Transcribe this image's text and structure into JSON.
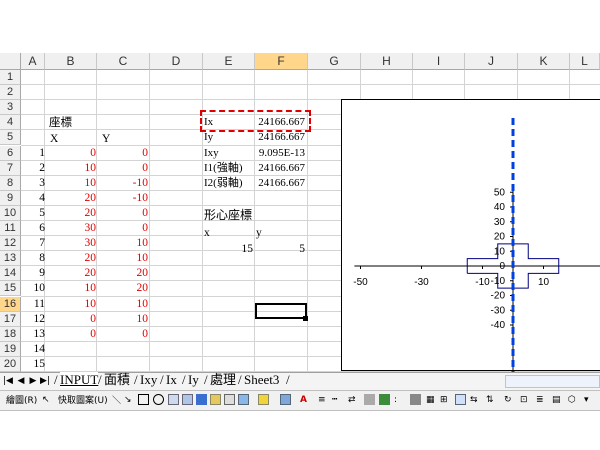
{
  "columns": [
    "A",
    "B",
    "C",
    "D",
    "E",
    "F",
    "G",
    "H",
    "I",
    "J",
    "K",
    "L"
  ],
  "selected_column": "F",
  "rows": [
    "1",
    "2",
    "3",
    "4",
    "5",
    "6",
    "7",
    "8",
    "9",
    "10",
    "11",
    "12",
    "13",
    "14",
    "15",
    "16",
    "17",
    "18",
    "19",
    "20"
  ],
  "selected_row": "16",
  "labels": {
    "coords_title": "座標",
    "x_header": "X",
    "y_header": "Y",
    "centroid_title": "形心座標",
    "centroid_x_label": "x",
    "centroid_y_label": "y"
  },
  "points": [
    {
      "n": "1",
      "x": "0",
      "y": "0"
    },
    {
      "n": "2",
      "x": "10",
      "y": "0"
    },
    {
      "n": "3",
      "x": "10",
      "y": "-10"
    },
    {
      "n": "4",
      "x": "20",
      "y": "-10"
    },
    {
      "n": "5",
      "x": "20",
      "y": "0"
    },
    {
      "n": "6",
      "x": "30",
      "y": "0"
    },
    {
      "n": "7",
      "x": "30",
      "y": "10"
    },
    {
      "n": "8",
      "x": "20",
      "y": "10"
    },
    {
      "n": "9",
      "x": "20",
      "y": "20"
    },
    {
      "n": "10",
      "x": "10",
      "y": "20"
    },
    {
      "n": "11",
      "x": "10",
      "y": "10"
    },
    {
      "n": "12",
      "x": "0",
      "y": "10"
    },
    {
      "n": "13",
      "x": "0",
      "y": "0"
    },
    {
      "n": "14",
      "x": "",
      "y": ""
    },
    {
      "n": "15",
      "x": "",
      "y": ""
    }
  ],
  "properties": [
    {
      "name": "Ix",
      "value": "24166.667"
    },
    {
      "name": "Iy",
      "value": "24166.667"
    },
    {
      "name": "Ixy",
      "value": "9.095E-13"
    },
    {
      "name": "I1(強軸)",
      "value": "24166.667"
    },
    {
      "name": "I2(弱軸)",
      "value": "24166.667"
    }
  ],
  "centroid": {
    "x": "15",
    "y": "5"
  },
  "tabs": [
    "INPUT",
    "面積",
    "Ixy",
    "Ix",
    "Iy",
    "處理",
    "Sheet3"
  ],
  "active_tab": "INPUT",
  "toolbar": {
    "draw_label": "繪圖(R)",
    "autoshapes_label": "快取圖案(U)"
  },
  "chart_data": {
    "type": "line",
    "x_ticks": [
      -50,
      -30,
      -10,
      10
    ],
    "y_ticks": [
      50,
      40,
      30,
      20,
      10,
      0,
      -10,
      -20,
      -30,
      -40
    ],
    "series": [
      {
        "x": [
          -15,
          -5,
          -5,
          5,
          5,
          15,
          15,
          5,
          5,
          -5,
          -5,
          -15,
          -15
        ],
        "y": [
          -5,
          -5,
          -15,
          -15,
          -5,
          -5,
          5,
          5,
          15,
          15,
          5,
          5,
          -5
        ]
      }
    ],
    "centroid_axis_x": 0,
    "colors": {
      "outline": "#000080",
      "centroid_axis": "#0040e0",
      "axes": "#000000"
    }
  }
}
